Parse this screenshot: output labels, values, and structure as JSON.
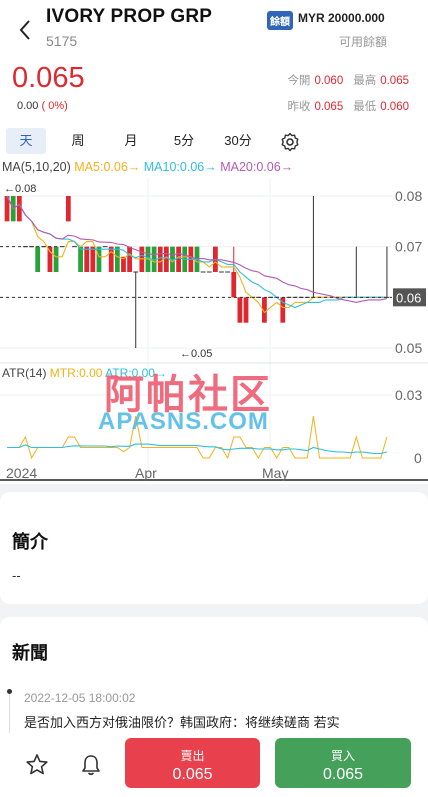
{
  "header": {
    "title": "IVORY PROP GRP",
    "code": "5175",
    "balance_badge": "餘額",
    "balance_value": "MYR 20000.000",
    "balance_label": "可用餘額"
  },
  "quote": {
    "price": "0.065",
    "change": "0.00",
    "change_pct": "( 0%)",
    "open_label": "今開",
    "open": "0.060",
    "high_label": "最高",
    "high": "0.065",
    "prev_close_label": "昨收",
    "prev_close": "0.065",
    "low_label": "最低",
    "low": "0.060"
  },
  "tabs": [
    "天",
    "周",
    "月",
    "5分",
    "30分"
  ],
  "active_tab": "天",
  "legend": {
    "ma": "MA(5,10,20)",
    "ma5": "MA5:0.06→",
    "ma10": "MA10:0.06→",
    "ma20": "MA20:0.06→",
    "atr": "ATR(14)",
    "mtr": "MTR:0.00",
    "atr_val": "ATR:0.00→"
  },
  "colors": {
    "up": "#e0272f",
    "down": "#28a23a",
    "ma5": "#f1b21a",
    "ma10": "#2fbfe0",
    "ma20": "#b55ab3",
    "accent": "#2f66b8"
  },
  "chart_data": {
    "type": "candlestick",
    "y_ticks": [
      "0.08",
      "0.07",
      "0.06",
      "0.05"
    ],
    "current_price_tag": "0.06",
    "ylim": [
      0.05,
      0.08
    ],
    "high_marker": "←0.08",
    "low_marker": "←0.05",
    "x_ticks": [
      "2024",
      "Apr",
      "May"
    ],
    "candles": [
      {
        "o": 0.075,
        "c": 0.08,
        "h": 0.08,
        "l": 0.075,
        "dir": "up"
      },
      {
        "o": 0.08,
        "c": 0.075,
        "h": 0.08,
        "l": 0.075,
        "dir": "down"
      },
      {
        "o": 0.075,
        "c": 0.08,
        "h": 0.08,
        "l": 0.075,
        "dir": "up"
      },
      {
        "o": 0.07,
        "c": 0.07,
        "h": 0.07,
        "l": 0.07,
        "dir": "flat"
      },
      {
        "o": 0.07,
        "c": 0.07,
        "h": 0.07,
        "l": 0.07,
        "dir": "flat"
      },
      {
        "o": 0.07,
        "c": 0.065,
        "h": 0.07,
        "l": 0.065,
        "dir": "down"
      },
      {
        "o": 0.07,
        "c": 0.07,
        "h": 0.07,
        "l": 0.07,
        "dir": "flat"
      },
      {
        "o": 0.065,
        "c": 0.07,
        "h": 0.07,
        "l": 0.065,
        "dir": "up"
      },
      {
        "o": 0.07,
        "c": 0.065,
        "h": 0.07,
        "l": 0.065,
        "dir": "down"
      },
      {
        "o": 0.07,
        "c": 0.07,
        "h": 0.07,
        "l": 0.07,
        "dir": "flat"
      },
      {
        "o": 0.075,
        "c": 0.08,
        "h": 0.08,
        "l": 0.075,
        "dir": "up"
      },
      {
        "o": 0.07,
        "c": 0.07,
        "h": 0.07,
        "l": 0.07,
        "dir": "flat"
      },
      {
        "o": 0.07,
        "c": 0.065,
        "h": 0.07,
        "l": 0.065,
        "dir": "down"
      },
      {
        "o": 0.065,
        "c": 0.07,
        "h": 0.07,
        "l": 0.065,
        "dir": "up"
      },
      {
        "o": 0.065,
        "c": 0.07,
        "h": 0.07,
        "l": 0.065,
        "dir": "up"
      },
      {
        "o": 0.07,
        "c": 0.065,
        "h": 0.07,
        "l": 0.065,
        "dir": "down"
      },
      {
        "o": 0.07,
        "c": 0.07,
        "h": 0.07,
        "l": 0.07,
        "dir": "flat"
      },
      {
        "o": 0.065,
        "c": 0.07,
        "h": 0.07,
        "l": 0.065,
        "dir": "up"
      },
      {
        "o": 0.07,
        "c": 0.065,
        "h": 0.07,
        "l": 0.065,
        "dir": "down"
      },
      {
        "o": 0.065,
        "c": 0.068,
        "h": 0.068,
        "l": 0.065,
        "dir": "up"
      },
      {
        "o": 0.065,
        "c": 0.07,
        "h": 0.07,
        "l": 0.065,
        "dir": "up"
      },
      {
        "o": 0.065,
        "c": 0.065,
        "h": 0.065,
        "l": 0.05,
        "dir": "flat"
      },
      {
        "o": 0.065,
        "c": 0.07,
        "h": 0.07,
        "l": 0.065,
        "dir": "up"
      },
      {
        "o": 0.07,
        "c": 0.065,
        "h": 0.07,
        "l": 0.065,
        "dir": "down"
      },
      {
        "o": 0.07,
        "c": 0.065,
        "h": 0.07,
        "l": 0.065,
        "dir": "down"
      },
      {
        "o": 0.065,
        "c": 0.07,
        "h": 0.07,
        "l": 0.065,
        "dir": "up"
      },
      {
        "o": 0.065,
        "c": 0.07,
        "h": 0.07,
        "l": 0.065,
        "dir": "up"
      },
      {
        "o": 0.07,
        "c": 0.065,
        "h": 0.07,
        "l": 0.065,
        "dir": "down"
      },
      {
        "o": 0.065,
        "c": 0.07,
        "h": 0.07,
        "l": 0.065,
        "dir": "up"
      },
      {
        "o": 0.07,
        "c": 0.065,
        "h": 0.07,
        "l": 0.065,
        "dir": "down"
      },
      {
        "o": 0.065,
        "c": 0.07,
        "h": 0.07,
        "l": 0.065,
        "dir": "up"
      },
      {
        "o": 0.07,
        "c": 0.065,
        "h": 0.07,
        "l": 0.065,
        "dir": "down"
      },
      {
        "o": 0.065,
        "c": 0.065,
        "h": 0.065,
        "l": 0.065,
        "dir": "flat"
      },
      {
        "o": 0.065,
        "c": 0.065,
        "h": 0.065,
        "l": 0.065,
        "dir": "flat"
      },
      {
        "o": 0.065,
        "c": 0.07,
        "h": 0.07,
        "l": 0.065,
        "dir": "up"
      },
      {
        "o": 0.065,
        "c": 0.065,
        "h": 0.065,
        "l": 0.065,
        "dir": "flat"
      },
      {
        "o": 0.065,
        "c": 0.065,
        "h": 0.065,
        "l": 0.065,
        "dir": "flat"
      },
      {
        "o": 0.06,
        "c": 0.065,
        "h": 0.07,
        "l": 0.06,
        "dir": "up"
      },
      {
        "o": 0.06,
        "c": 0.055,
        "h": 0.06,
        "l": 0.055,
        "dir": "up"
      },
      {
        "o": 0.06,
        "c": 0.055,
        "h": 0.06,
        "l": 0.055,
        "dir": "up"
      },
      {
        "o": 0.06,
        "c": 0.06,
        "h": 0.06,
        "l": 0.06,
        "dir": "flat"
      },
      {
        "o": 0.06,
        "c": 0.06,
        "h": 0.06,
        "l": 0.06,
        "dir": "flat"
      },
      {
        "o": 0.06,
        "c": 0.055,
        "h": 0.06,
        "l": 0.055,
        "dir": "up"
      },
      {
        "o": 0.06,
        "c": 0.06,
        "h": 0.06,
        "l": 0.06,
        "dir": "flat"
      },
      {
        "o": 0.06,
        "c": 0.06,
        "h": 0.06,
        "l": 0.06,
        "dir": "flat"
      },
      {
        "o": 0.06,
        "c": 0.055,
        "h": 0.06,
        "l": 0.055,
        "dir": "up"
      },
      {
        "o": 0.06,
        "c": 0.06,
        "h": 0.06,
        "l": 0.06,
        "dir": "flat"
      },
      {
        "o": 0.06,
        "c": 0.06,
        "h": 0.06,
        "l": 0.06,
        "dir": "flat"
      },
      {
        "o": 0.06,
        "c": 0.06,
        "h": 0.06,
        "l": 0.06,
        "dir": "flat"
      },
      {
        "o": 0.06,
        "c": 0.06,
        "h": 0.06,
        "l": 0.06,
        "dir": "flat"
      },
      {
        "o": 0.06,
        "c": 0.06,
        "h": 0.08,
        "l": 0.06,
        "dir": "flat"
      },
      {
        "o": 0.06,
        "c": 0.06,
        "h": 0.06,
        "l": 0.06,
        "dir": "flat"
      },
      {
        "o": 0.06,
        "c": 0.06,
        "h": 0.06,
        "l": 0.06,
        "dir": "flat"
      },
      {
        "o": 0.06,
        "c": 0.06,
        "h": 0.06,
        "l": 0.06,
        "dir": "flat"
      },
      {
        "o": 0.06,
        "c": 0.06,
        "h": 0.06,
        "l": 0.06,
        "dir": "flat"
      },
      {
        "o": 0.06,
        "c": 0.06,
        "h": 0.06,
        "l": 0.06,
        "dir": "flat"
      },
      {
        "o": 0.06,
        "c": 0.06,
        "h": 0.06,
        "l": 0.06,
        "dir": "flat"
      },
      {
        "o": 0.06,
        "c": 0.06,
        "h": 0.07,
        "l": 0.06,
        "dir": "flat"
      },
      {
        "o": 0.06,
        "c": 0.06,
        "h": 0.06,
        "l": 0.06,
        "dir": "flat"
      },
      {
        "o": 0.06,
        "c": 0.06,
        "h": 0.06,
        "l": 0.06,
        "dir": "flat"
      },
      {
        "o": 0.06,
        "c": 0.06,
        "h": 0.06,
        "l": 0.06,
        "dir": "flat"
      },
      {
        "o": 0.06,
        "c": 0.06,
        "h": 0.06,
        "l": 0.06,
        "dir": "flat"
      },
      {
        "o": 0.06,
        "c": 0.06,
        "h": 0.07,
        "l": 0.06,
        "dir": "flat"
      }
    ],
    "atr_y_ticks": [
      "0.03",
      "0"
    ],
    "atr_ylim": [
      0,
      0.03
    ]
  },
  "intro": {
    "title": "簡介",
    "value": "--"
  },
  "news": {
    "title": "新聞",
    "items": [
      {
        "time": "2022-12-05 18:00:02",
        "title": "是否加入西方对俄油限价？韩国政府：将继续磋商 若实"
      }
    ]
  },
  "actions": {
    "sell_label": "賣出",
    "sell_price": "0.065",
    "buy_label": "買入",
    "buy_price": "0.065"
  },
  "watermark": {
    "line1": "阿帕社区",
    "line2": "APASNS.COM"
  }
}
